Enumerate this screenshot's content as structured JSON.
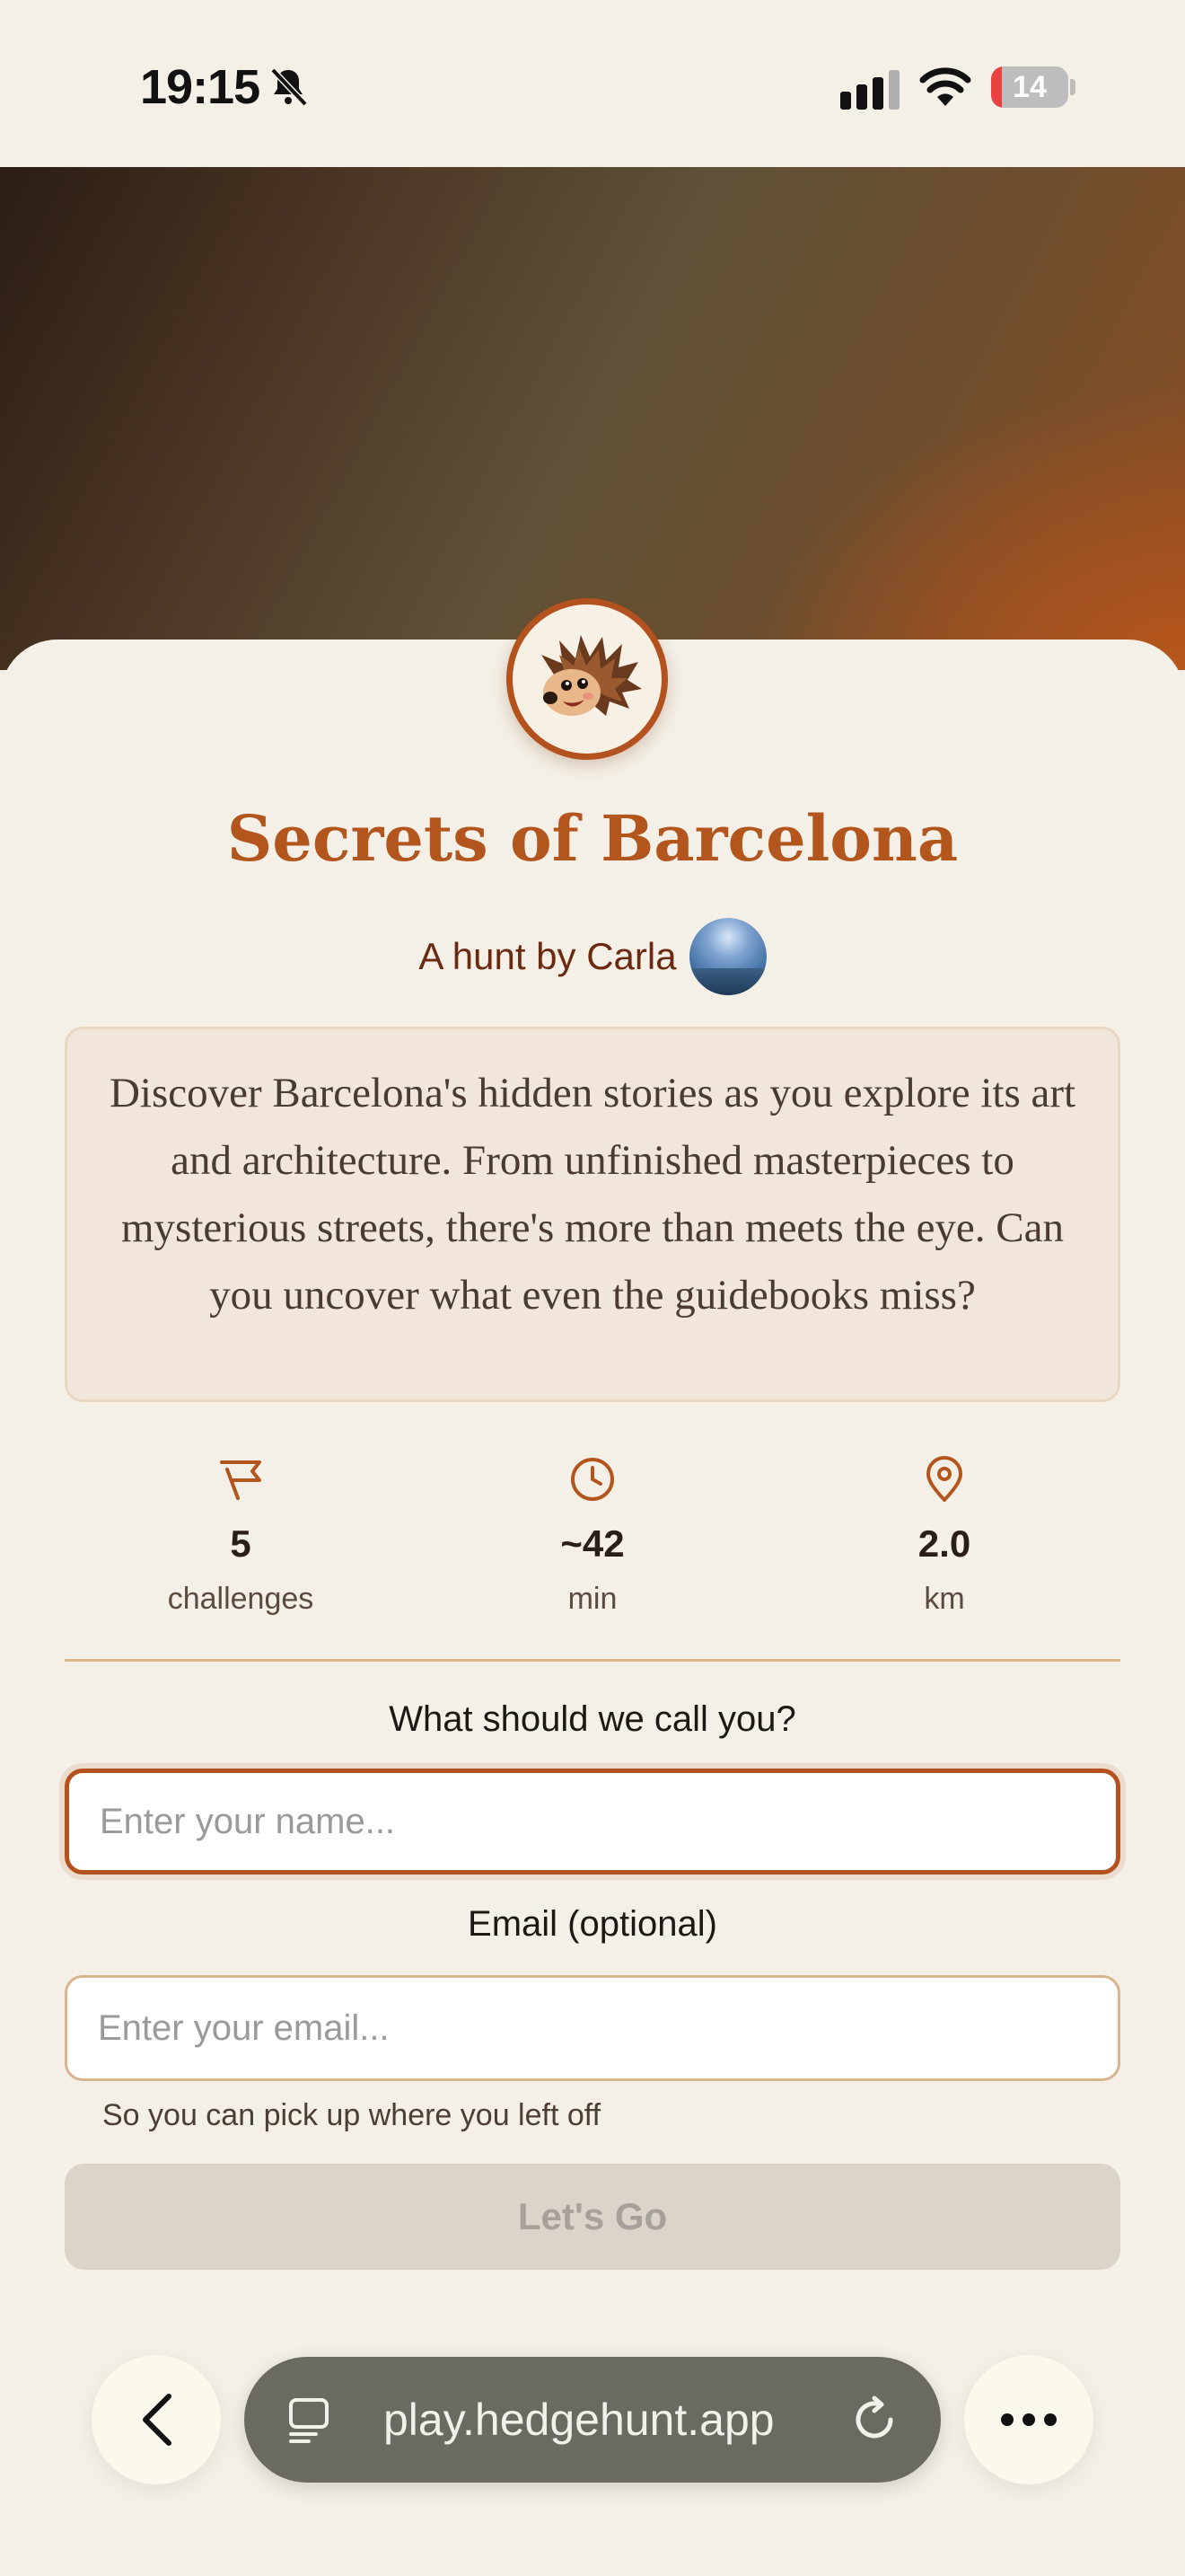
{
  "status_bar": {
    "time": "19:15",
    "battery": "14",
    "battery_level": 0.14
  },
  "hunt": {
    "title": "Secrets of Barcelona",
    "byline": "A hunt by Carla",
    "description": "Discover Barcelona's hidden stories as you explore its art and architecture. From unfinished masterpieces to mysterious streets, there's more than meets the eye. Can you uncover what even the guidebooks miss?"
  },
  "stats": [
    {
      "icon": "flag-icon",
      "value": "5",
      "unit": "challenges"
    },
    {
      "icon": "clock-icon",
      "value": "~42",
      "unit": "min"
    },
    {
      "icon": "location-pin-icon",
      "value": "2.0",
      "unit": "km"
    }
  ],
  "form": {
    "name_label": "What should we call you?",
    "name_placeholder": "Enter your name...",
    "email_label": "Email (optional)",
    "email_placeholder": "Enter your email...",
    "email_helper": "So you can pick up where you left off",
    "submit_label": "Let's Go"
  },
  "browser": {
    "url": "play.hedgehunt.app"
  },
  "colors": {
    "accent": "#B3521E",
    "background": "#F4F0E8",
    "title": "#B3561E",
    "button_disabled": "#DCD3CA"
  }
}
